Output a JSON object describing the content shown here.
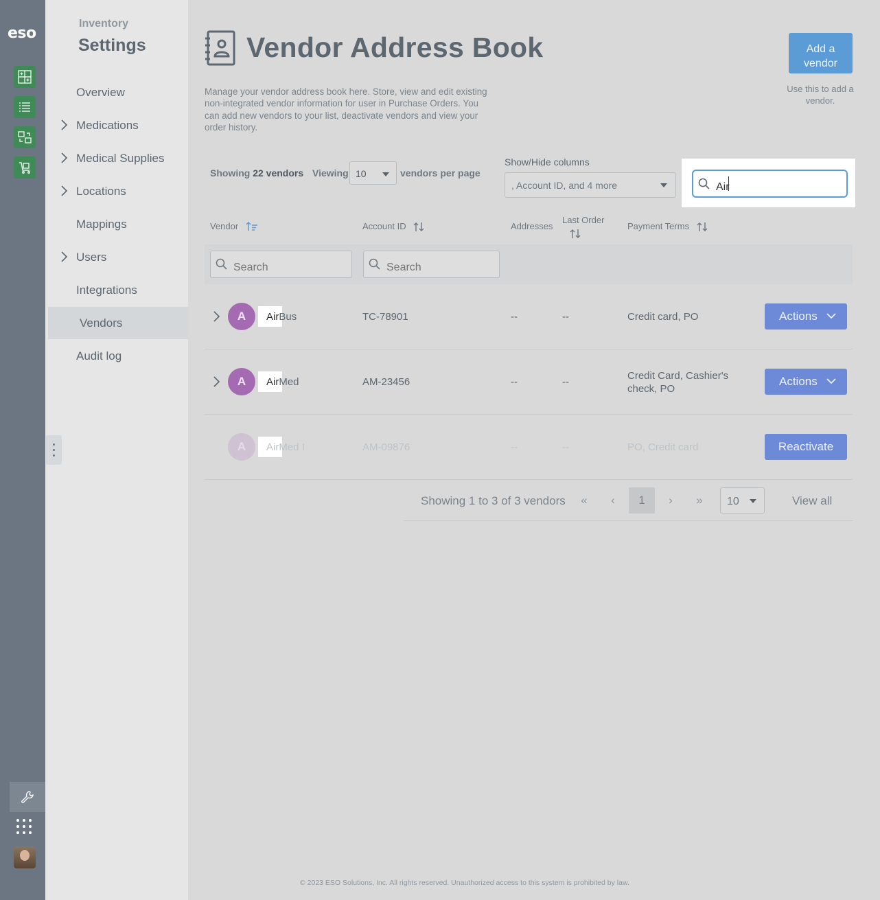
{
  "rail": {
    "logo": "eso",
    "apps": [
      "inventory-app-icon",
      "list-app-icon",
      "transfer-app-icon",
      "cart-app-icon"
    ],
    "bottom": [
      "wrench-icon",
      "apps-grid-icon",
      "user-avatar"
    ]
  },
  "subnav": {
    "kicker": "Inventory",
    "heading": "Settings",
    "items": [
      {
        "label": "Overview",
        "expandable": false
      },
      {
        "label": "Medications",
        "expandable": true
      },
      {
        "label": "Medical Supplies",
        "expandable": true
      },
      {
        "label": "Locations",
        "expandable": true
      },
      {
        "label": "Mappings",
        "expandable": false
      },
      {
        "label": "Users",
        "expandable": true
      },
      {
        "label": "Integrations",
        "expandable": false
      },
      {
        "label": "Vendors",
        "expandable": false,
        "active": true
      },
      {
        "label": "Audit log",
        "expandable": false
      }
    ]
  },
  "header": {
    "title": "Vendor Address Book",
    "description": "Manage your vendor address book here. Store, view and edit existing non-integrated vendor information for user in Purchase Orders. You can add new vendors to your list, deactivate vendors and view your order history.",
    "add_button_line1": "Add a",
    "add_button_line2": "vendor",
    "add_help": "Use this to add a vendor."
  },
  "toolbar": {
    "showing_prefix": "Showing",
    "showing_count": "22 vendors",
    "viewing_label": "Viewing",
    "per_page_value": "10",
    "per_page_suffix": "vendors per page",
    "columns_label": "Show/Hide columns",
    "columns_value": ", Account ID, and 4 more",
    "search_value": "Air"
  },
  "table": {
    "columns": {
      "vendor": "Vendor",
      "account_id": "Account ID",
      "addresses": "Addresses",
      "last_order": "Last Order",
      "payment_terms": "Payment Terms"
    },
    "filter_placeholder": "Search",
    "rows": [
      {
        "initial": "A",
        "match": "Air",
        "rest": "Bus",
        "account_id": "TC-78901",
        "addresses": "--",
        "last_order": "--",
        "payment_terms": "Credit card, PO",
        "action": "Actions",
        "active": true
      },
      {
        "initial": "A",
        "match": "Air",
        "rest": "Med",
        "account_id": "AM-23456",
        "addresses": "--",
        "last_order": "--",
        "payment_terms": "Credit Card, Cashier's check, PO",
        "action": "Actions",
        "active": true
      },
      {
        "initial": "A",
        "match": "Air",
        "rest": "Med I",
        "account_id": "AM-09876",
        "addresses": "--",
        "last_order": "--",
        "payment_terms": "PO, Credit card",
        "action": "Reactivate",
        "active": false
      }
    ]
  },
  "pagination": {
    "summary": "Showing 1 to 3 of 3 vendors",
    "first": "«",
    "prev": "‹",
    "current_page": "1",
    "next": "›",
    "last": "»",
    "page_size": "10",
    "view_all": "View all"
  },
  "footer": "© 2023 ESO Solutions, Inc. All rights reserved. Unauthorized access to this system is prohibited by law.",
  "colors": {
    "accent_blue": "#5b9cd6",
    "action_blue": "#6c8ad8",
    "app_green": "#3f8a56",
    "avatar_purple": "#a56bb2"
  }
}
